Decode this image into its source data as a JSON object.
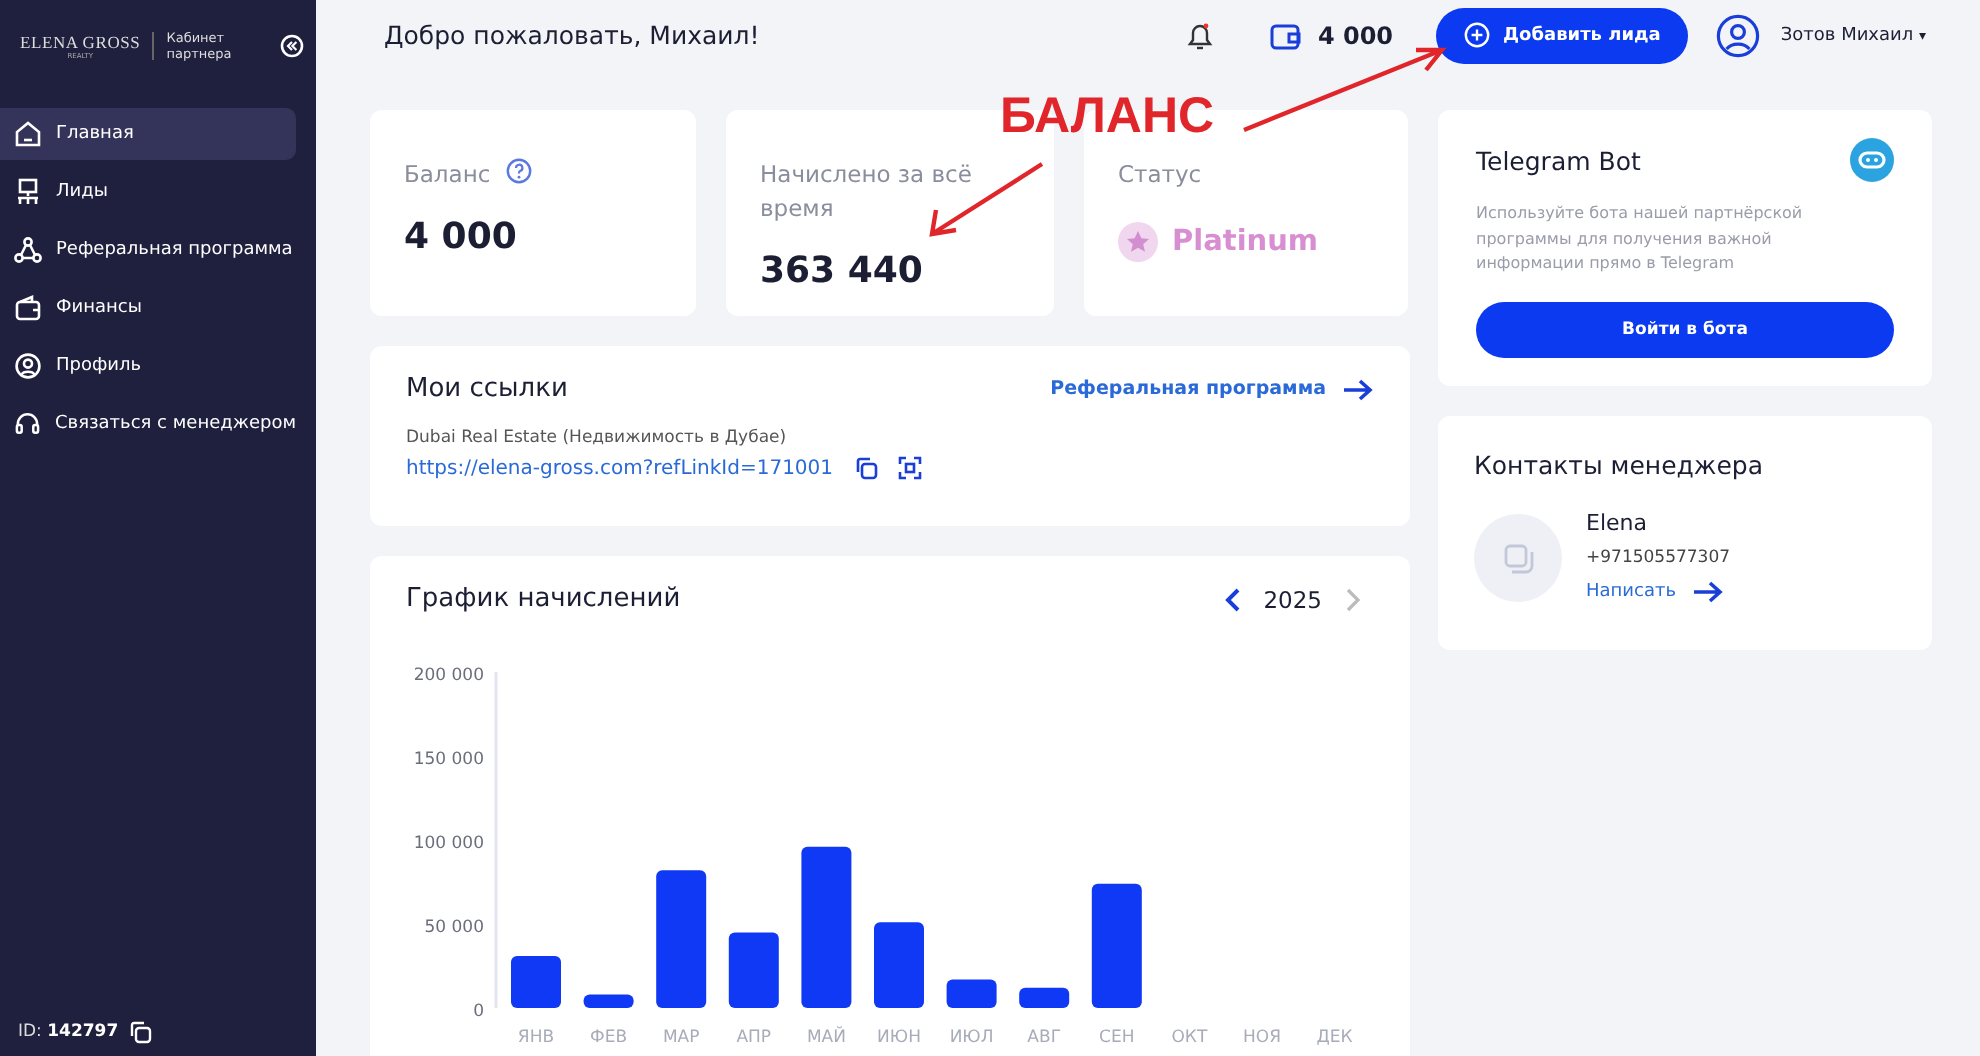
{
  "sidebar": {
    "logo": "ELENA GROSS",
    "logo_sub": "REALTY",
    "cabinet": "Кабинет партнера",
    "items": [
      {
        "label": "Главная",
        "selected": true
      },
      {
        "label": "Лиды",
        "selected": false
      },
      {
        "label": "Реферальная программа",
        "selected": false
      },
      {
        "label": "Финансы",
        "selected": false
      },
      {
        "label": "Профиль",
        "selected": false
      },
      {
        "label": "Связаться с менеджером",
        "selected": false
      }
    ],
    "id_label": "ID:",
    "id_value": "142797"
  },
  "header": {
    "greeting": "Добро пожаловать, Михаил!",
    "balance": "4 000",
    "add_button": "Добавить лида",
    "user": "Зотов Михаил",
    "user_caret": "▾"
  },
  "stats": [
    {
      "kind": "value",
      "label": "Баланс",
      "help": true,
      "value": "4 000"
    },
    {
      "kind": "value",
      "label": "Начислено за всё время",
      "help": false,
      "value": "363 440"
    },
    {
      "kind": "status",
      "label": "Статус",
      "value": "Platinum"
    }
  ],
  "links": {
    "title": "Мои ссылки",
    "more": "Реферальная программа",
    "items": [
      {
        "name": "Dubai Real Estate (Недвижимость в Дубае)",
        "url": "https://elena-gross.com?refLinkId=171001"
      }
    ]
  },
  "chart": {
    "title": "График начислений",
    "year": "2025",
    "prev_enabled": true,
    "next_enabled": false,
    "chart_data": {
      "type": "bar",
      "categories": [
        "ЯНВ",
        "ФЕВ",
        "МАР",
        "АПР",
        "МАЙ",
        "ИЮН",
        "ИЮЛ",
        "АВГ",
        "СЕН",
        "ОКТ",
        "НОЯ",
        "ДЕК"
      ],
      "series": [
        {
          "color": "#1039f5",
          "values": [
            31000,
            8000,
            82000,
            45000,
            96000,
            51000,
            17000,
            12000,
            74000,
            null,
            null,
            null
          ]
        }
      ],
      "ylim": [
        0,
        200000
      ],
      "yticks": [
        {
          "value": 0,
          "label": "0"
        },
        {
          "value": 50000,
          "label": "50 000"
        },
        {
          "value": 100000,
          "label": "100 000"
        },
        {
          "value": 150000,
          "label": "150 000"
        },
        {
          "value": 200000,
          "label": "200 000"
        }
      ]
    }
  },
  "telegram": {
    "title": "Telegram Bot",
    "text": "Используйте бота нашей партнёрской программы для получения важной информации прямо в Telegram",
    "button": "Войти в бота"
  },
  "manager": {
    "title": "Контакты менеджера",
    "name": "Elena",
    "phone": "+971505577307",
    "write": "Написать"
  },
  "annotation": {
    "text": "БАЛАНС"
  }
}
